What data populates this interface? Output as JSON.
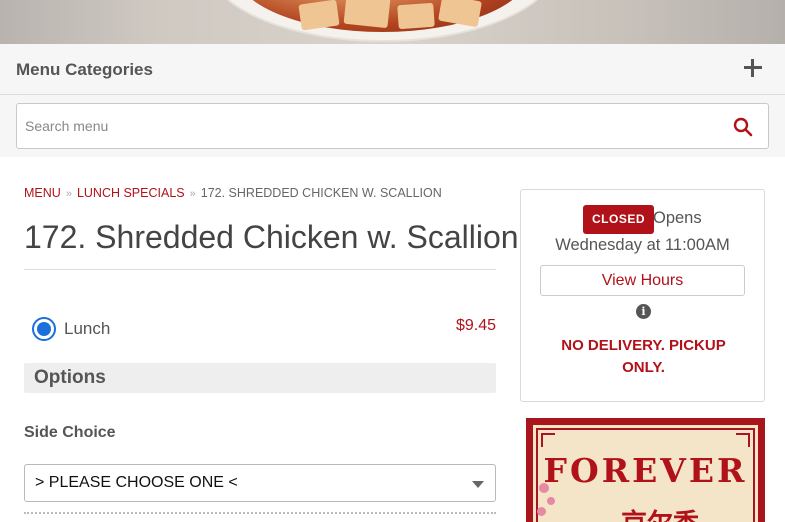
{
  "header": {
    "menu_categories_label": "Menu Categories",
    "search_placeholder": "Search menu"
  },
  "breadcrumb": {
    "items": [
      "MENU",
      "LUNCH SPECIALS",
      "172. SHREDDED CHICKEN W. SCALLION"
    ]
  },
  "item": {
    "title": "172. Shredded Chicken w. Scallion",
    "size_option": "Lunch",
    "price": "$9.45",
    "options_heading": "Options",
    "side_choice_label": "Side Choice",
    "side_choice_value": "> PLEASE CHOOSE ONE <"
  },
  "store": {
    "status_badge": "CLOSED",
    "opens_label": "Opens",
    "opens_time": "Wednesday at 11:00AM",
    "view_hours_label": "View Hours",
    "info_icon": "i",
    "delivery_note": "NO DELIVERY. PICKUP ONLY."
  },
  "logo": {
    "wordmark": "FOREVER",
    "chinese": "京尔香"
  },
  "icons": {
    "expand": "plus-icon",
    "search": "search-icon",
    "info": "info-icon",
    "caret": "chevron-down-icon"
  },
  "colors": {
    "accent": "#b1121a",
    "radio": "#1a6fdb"
  }
}
